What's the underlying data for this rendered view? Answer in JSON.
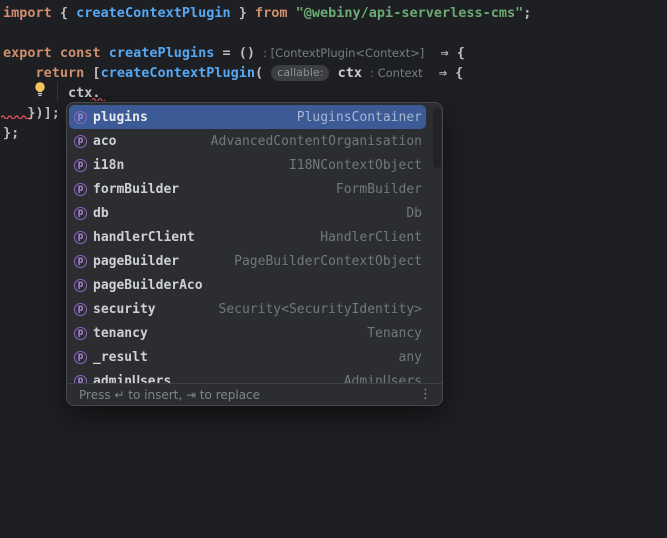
{
  "editor": {
    "background_color": "#1e1f22",
    "syntax_colors": {
      "keyword": "#cf8e6d",
      "identifier_blue": "#56a8f5",
      "string_green": "#6aab73",
      "plain": "#bcbec4",
      "inlay_hint": "#787c84",
      "error_squiggle": "#f75464"
    },
    "lines": [
      {
        "tokens": [
          {
            "t": "import",
            "s": "kw"
          },
          {
            "t": " { ",
            "s": "pln"
          },
          {
            "t": "createContextPlugin",
            "s": "fn"
          },
          {
            "t": " } ",
            "s": "pln"
          },
          {
            "t": "from",
            "s": "kw"
          },
          {
            "t": " ",
            "s": "pln"
          },
          {
            "t": "\"@webiny/api-serverless-cms\"",
            "s": "str"
          },
          {
            "t": ";",
            "s": "pln"
          }
        ]
      },
      {
        "tokens": []
      },
      {
        "tokens": [
          {
            "t": "export",
            "s": "kw"
          },
          {
            "t": " ",
            "s": "pln"
          },
          {
            "t": "const",
            "s": "kw"
          },
          {
            "t": " ",
            "s": "pln"
          },
          {
            "t": "createPlugins",
            "s": "fn"
          },
          {
            "t": " = () ",
            "s": "pln"
          },
          {
            "t": ": [ContextPlugin<Context>]",
            "s": "inlay"
          },
          {
            "t": "  ⇒ {",
            "s": "pln"
          }
        ]
      },
      {
        "tokens": [
          {
            "t": "    ",
            "s": "pln"
          },
          {
            "t": "return",
            "s": "kw"
          },
          {
            "t": " [",
            "s": "pln"
          },
          {
            "t": "createContextPlugin",
            "s": "fn"
          },
          {
            "t": "( ",
            "s": "pln"
          },
          {
            "t": "callable:",
            "s": "pill"
          },
          {
            "t": " ",
            "s": "pln"
          },
          {
            "t": "ctx ",
            "s": "bold"
          },
          {
            "t": ": Context",
            "s": "inlay"
          },
          {
            "t": "  ⇒ {",
            "s": "pln"
          }
        ]
      },
      {
        "tokens": [
          {
            "t": "        ",
            "s": "pln"
          },
          {
            "t": "ctx.",
            "s": "bold"
          }
        ]
      },
      {
        "tokens": [
          {
            "t": "   ",
            "s": "pln"
          },
          {
            "t": "})];",
            "s": "pln"
          }
        ]
      },
      {
        "tokens": [
          {
            "t": "};",
            "s": "pln"
          }
        ]
      }
    ]
  },
  "completion": {
    "selection_color": "#3c5a96",
    "property_icon_color": "#a988dd",
    "item_icon_glyph": "p",
    "selected_index": 0,
    "items": [
      {
        "name": "plugins",
        "type": "PluginsContainer"
      },
      {
        "name": "aco",
        "type": "AdvancedContentOrganisation"
      },
      {
        "name": "i18n",
        "type": "I18NContextObject"
      },
      {
        "name": "formBuilder",
        "type": "FormBuilder"
      },
      {
        "name": "db",
        "type": "Db"
      },
      {
        "name": "handlerClient",
        "type": "HandlerClient"
      },
      {
        "name": "pageBuilder",
        "type": "PageBuilderContextObject"
      },
      {
        "name": "pageBuilderAco",
        "type": ""
      },
      {
        "name": "security",
        "type": "Security<SecurityIdentity>"
      },
      {
        "name": "tenancy",
        "type": "Tenancy"
      },
      {
        "name": "_result",
        "type": "any"
      },
      {
        "name": "adminUsers",
        "type": "AdminUsers"
      }
    ],
    "footer_hint": "Press ↵ to insert, ⇥ to replace",
    "more_icon_glyph": "⋮"
  }
}
